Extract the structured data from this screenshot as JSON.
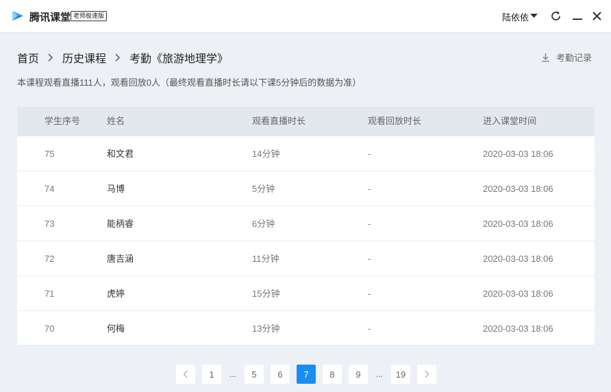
{
  "window": {
    "app_name": "腾讯课堂",
    "edition": "老师极速版",
    "user_name": "陆依依",
    "colors": {
      "accent": "#1a8ef0",
      "logo": "#2ba6f0"
    }
  },
  "breadcrumb": {
    "items": [
      "首页",
      "历史课程",
      "考勤《旅游地理学》"
    ]
  },
  "attendance_link": "考勤记录",
  "summary": "本课程观看直播111人，观看回放0人（最终观看直播时长请以下课5分钟后的数据为准）",
  "table": {
    "headers": [
      "学生序号",
      "姓名",
      "观看直播时长",
      "观看回放时长",
      "进入课堂时间"
    ],
    "rows": [
      [
        "75",
        "和文君",
        "14分钟",
        "-",
        "2020-03-03 18:06"
      ],
      [
        "74",
        "马博",
        "5分钟",
        "-",
        "2020-03-03 18:06"
      ],
      [
        "73",
        "能柄睿",
        "6分钟",
        "-",
        "2020-03-03 18:06"
      ],
      [
        "72",
        "唐吉涵",
        "11分钟",
        "-",
        "2020-03-03 18:06"
      ],
      [
        "71",
        "虎婷",
        "15分钟",
        "-",
        "2020-03-03 18:06"
      ],
      [
        "70",
        "何梅",
        "13分钟",
        "-",
        "2020-03-03 18:06"
      ]
    ]
  },
  "pagination": {
    "first": "1",
    "dots": "...",
    "pages": [
      "5",
      "6",
      "7",
      "8",
      "9"
    ],
    "last": "19",
    "current": "7"
  }
}
